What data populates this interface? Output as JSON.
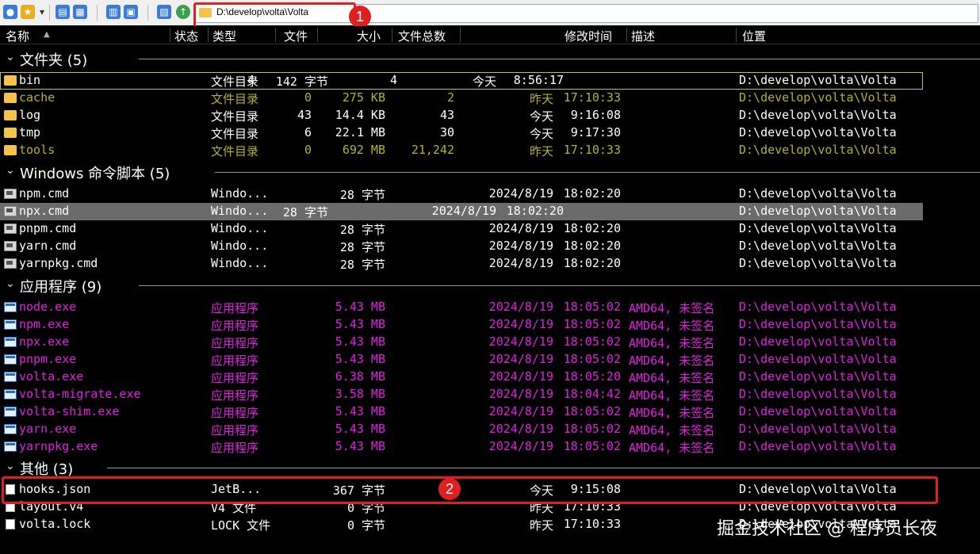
{
  "address": {
    "path": "D:\\develop\\volta\\Volta"
  },
  "annotations": [
    "1",
    "2"
  ],
  "columns": [
    "名称",
    "状态",
    "类型",
    "文件",
    "大小",
    "文件总数",
    "修改时间",
    "描述",
    "位置"
  ],
  "sort_indicator": "▲",
  "groups": [
    {
      "title": "文件夹 (5)",
      "rows": [
        {
          "icon": "folder",
          "name": "bin",
          "type": "文件目录",
          "files": "4",
          "size": "142 字节",
          "total": "4",
          "date": "今天",
          "time": "8:56:17",
          "desc": "",
          "loc": "D:\\develop\\volta\\Volta",
          "color": "#ffffff"
        },
        {
          "icon": "folder",
          "name": "cache",
          "type": "文件目录",
          "files": "0",
          "size": "275 KB",
          "total": "2",
          "date": "昨天",
          "time": "17:10:33",
          "desc": "",
          "loc": "D:\\develop\\volta\\Volta",
          "color": "#b4b41e"
        },
        {
          "icon": "folder",
          "name": "log",
          "type": "文件目录",
          "files": "43",
          "size": "14.4 KB",
          "total": "43",
          "date": "今天",
          "time": "9:16:08",
          "desc": "",
          "loc": "D:\\develop\\volta\\Volta",
          "color": "#ffffff"
        },
        {
          "icon": "folder",
          "name": "tmp",
          "type": "文件目录",
          "files": "6",
          "size": "22.1 MB",
          "total": "30",
          "date": "今天",
          "time": "9:17:30",
          "desc": "",
          "loc": "D:\\develop\\volta\\Volta",
          "color": "#ffffff"
        },
        {
          "icon": "folder",
          "name": "tools",
          "type": "文件目录",
          "files": "0",
          "size": "692 MB",
          "total": "21,242",
          "date": "昨天",
          "time": "17:10:33",
          "desc": "",
          "loc": "D:\\develop\\volta\\Volta",
          "color": "#b4b41e"
        }
      ]
    },
    {
      "title": "Windows 命令脚本 (5)",
      "rows": [
        {
          "icon": "cmd",
          "name": "npm.cmd",
          "type": "Windo...",
          "files": "",
          "size": "28 字节",
          "total": "",
          "date": "2024/8/19",
          "time": "18:02:20",
          "desc": "",
          "loc": "D:\\develop\\volta\\Volta",
          "color": "#ffffff"
        },
        {
          "icon": "cmd",
          "name": "npx.cmd",
          "type": "Windo...",
          "files": "",
          "size": "28 字节",
          "total": "",
          "date": "2024/8/19",
          "time": "18:02:20",
          "desc": "",
          "loc": "D:\\develop\\volta\\Volta",
          "color": "#ffffff"
        },
        {
          "icon": "cmd",
          "name": "pnpm.cmd",
          "type": "Windo...",
          "files": "",
          "size": "28 字节",
          "total": "",
          "date": "2024/8/19",
          "time": "18:02:20",
          "desc": "",
          "loc": "D:\\develop\\volta\\Volta",
          "color": "#ffffff"
        },
        {
          "icon": "cmd",
          "name": "yarn.cmd",
          "type": "Windo...",
          "files": "",
          "size": "28 字节",
          "total": "",
          "date": "2024/8/19",
          "time": "18:02:20",
          "desc": "",
          "loc": "D:\\develop\\volta\\Volta",
          "color": "#ffffff"
        },
        {
          "icon": "cmd",
          "name": "yarnpkg.cmd",
          "type": "Windo...",
          "files": "",
          "size": "28 字节",
          "total": "",
          "date": "2024/8/19",
          "time": "18:02:20",
          "desc": "",
          "loc": "D:\\develop\\volta\\Volta",
          "color": "#ffffff"
        }
      ]
    },
    {
      "title": "应用程序 (9)",
      "rows": [
        {
          "icon": "exe",
          "name": "node.exe",
          "type": "应用程序",
          "files": "",
          "size": "5.43 MB",
          "total": "",
          "date": "2024/8/19",
          "time": "18:05:02",
          "desc": "AMD64, 未签名",
          "loc": "D:\\develop\\volta\\Volta",
          "color": "#e020e0"
        },
        {
          "icon": "exe",
          "name": "npm.exe",
          "type": "应用程序",
          "files": "",
          "size": "5.43 MB",
          "total": "",
          "date": "2024/8/19",
          "time": "18:05:02",
          "desc": "AMD64, 未签名",
          "loc": "D:\\develop\\volta\\Volta",
          "color": "#e020e0"
        },
        {
          "icon": "exe",
          "name": "npx.exe",
          "type": "应用程序",
          "files": "",
          "size": "5.43 MB",
          "total": "",
          "date": "2024/8/19",
          "time": "18:05:02",
          "desc": "AMD64, 未签名",
          "loc": "D:\\develop\\volta\\Volta",
          "color": "#e020e0"
        },
        {
          "icon": "exe",
          "name": "pnpm.exe",
          "type": "应用程序",
          "files": "",
          "size": "5.43 MB",
          "total": "",
          "date": "2024/8/19",
          "time": "18:05:02",
          "desc": "AMD64, 未签名",
          "loc": "D:\\develop\\volta\\Volta",
          "color": "#e020e0"
        },
        {
          "icon": "exe",
          "name": "volta.exe",
          "type": "应用程序",
          "files": "",
          "size": "6.38 MB",
          "total": "",
          "date": "2024/8/19",
          "time": "18:05:20",
          "desc": "AMD64, 未签名",
          "loc": "D:\\develop\\volta\\Volta",
          "color": "#e020e0"
        },
        {
          "icon": "exe",
          "name": "volta-migrate.exe",
          "type": "应用程序",
          "files": "",
          "size": "3.58 MB",
          "total": "",
          "date": "2024/8/19",
          "time": "18:04:42",
          "desc": "AMD64, 未签名",
          "loc": "D:\\develop\\volta\\Volta",
          "color": "#e020e0"
        },
        {
          "icon": "exe",
          "name": "volta-shim.exe",
          "type": "应用程序",
          "files": "",
          "size": "5.43 MB",
          "total": "",
          "date": "2024/8/19",
          "time": "18:05:02",
          "desc": "AMD64, 未签名",
          "loc": "D:\\develop\\volta\\Volta",
          "color": "#e020e0"
        },
        {
          "icon": "exe",
          "name": "yarn.exe",
          "type": "应用程序",
          "files": "",
          "size": "5.43 MB",
          "total": "",
          "date": "2024/8/19",
          "time": "18:05:02",
          "desc": "AMD64, 未签名",
          "loc": "D:\\develop\\volta\\Volta",
          "color": "#e020e0"
        },
        {
          "icon": "exe",
          "name": "yarnpkg.exe",
          "type": "应用程序",
          "files": "",
          "size": "5.43 MB",
          "total": "",
          "date": "2024/8/19",
          "time": "18:05:02",
          "desc": "AMD64, 未签名",
          "loc": "D:\\develop\\volta\\Volta",
          "color": "#e020e0"
        }
      ]
    },
    {
      "title": "其他 (3)",
      "rows": [
        {
          "icon": "file",
          "name": "hooks.json",
          "type": "JetB...",
          "files": "",
          "size": "367 字节",
          "total": "",
          "date": "今天",
          "time": "9:15:08",
          "desc": "",
          "loc": "D:\\develop\\volta\\Volta",
          "color": "#ffffff"
        },
        {
          "icon": "file",
          "name": "layout.v4",
          "type": "V4 文件",
          "files": "",
          "size": "0 字节",
          "total": "",
          "date": "昨天",
          "time": "17:10:33",
          "desc": "",
          "loc": "D:\\develop\\volta\\Volta",
          "color": "#ffffff"
        },
        {
          "icon": "file",
          "name": "volta.lock",
          "type": "LOCK 文件",
          "files": "",
          "size": "0 字节",
          "total": "",
          "date": "昨天",
          "time": "17:10:33",
          "desc": "",
          "loc": "D:\\develop\\volta\\Volta",
          "color": "#ffffff"
        }
      ]
    }
  ],
  "watermark": "掘金技术社区 @ 程序员长夜"
}
